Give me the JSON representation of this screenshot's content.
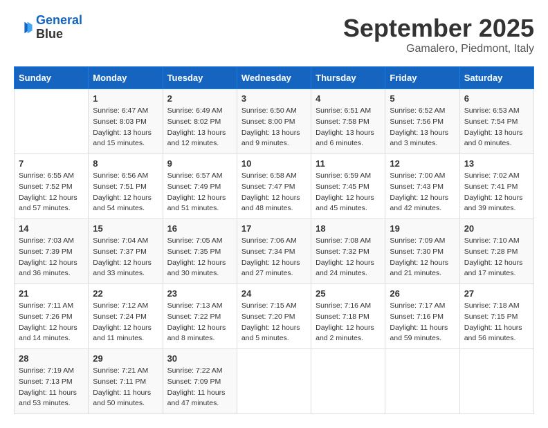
{
  "header": {
    "logo_line1": "General",
    "logo_line2": "Blue",
    "month": "September 2025",
    "location": "Gamalero, Piedmont, Italy"
  },
  "weekdays": [
    "Sunday",
    "Monday",
    "Tuesday",
    "Wednesday",
    "Thursday",
    "Friday",
    "Saturday"
  ],
  "weeks": [
    [
      null,
      {
        "day": "1",
        "sunrise": "6:47 AM",
        "sunset": "8:03 PM",
        "daylight": "13 hours and 15 minutes."
      },
      {
        "day": "2",
        "sunrise": "6:49 AM",
        "sunset": "8:02 PM",
        "daylight": "13 hours and 12 minutes."
      },
      {
        "day": "3",
        "sunrise": "6:50 AM",
        "sunset": "8:00 PM",
        "daylight": "13 hours and 9 minutes."
      },
      {
        "day": "4",
        "sunrise": "6:51 AM",
        "sunset": "7:58 PM",
        "daylight": "13 hours and 6 minutes."
      },
      {
        "day": "5",
        "sunrise": "6:52 AM",
        "sunset": "7:56 PM",
        "daylight": "13 hours and 3 minutes."
      },
      {
        "day": "6",
        "sunrise": "6:53 AM",
        "sunset": "7:54 PM",
        "daylight": "13 hours and 0 minutes."
      }
    ],
    [
      {
        "day": "7",
        "sunrise": "6:55 AM",
        "sunset": "7:52 PM",
        "daylight": "12 hours and 57 minutes."
      },
      {
        "day": "8",
        "sunrise": "6:56 AM",
        "sunset": "7:51 PM",
        "daylight": "12 hours and 54 minutes."
      },
      {
        "day": "9",
        "sunrise": "6:57 AM",
        "sunset": "7:49 PM",
        "daylight": "12 hours and 51 minutes."
      },
      {
        "day": "10",
        "sunrise": "6:58 AM",
        "sunset": "7:47 PM",
        "daylight": "12 hours and 48 minutes."
      },
      {
        "day": "11",
        "sunrise": "6:59 AM",
        "sunset": "7:45 PM",
        "daylight": "12 hours and 45 minutes."
      },
      {
        "day": "12",
        "sunrise": "7:00 AM",
        "sunset": "7:43 PM",
        "daylight": "12 hours and 42 minutes."
      },
      {
        "day": "13",
        "sunrise": "7:02 AM",
        "sunset": "7:41 PM",
        "daylight": "12 hours and 39 minutes."
      }
    ],
    [
      {
        "day": "14",
        "sunrise": "7:03 AM",
        "sunset": "7:39 PM",
        "daylight": "12 hours and 36 minutes."
      },
      {
        "day": "15",
        "sunrise": "7:04 AM",
        "sunset": "7:37 PM",
        "daylight": "12 hours and 33 minutes."
      },
      {
        "day": "16",
        "sunrise": "7:05 AM",
        "sunset": "7:35 PM",
        "daylight": "12 hours and 30 minutes."
      },
      {
        "day": "17",
        "sunrise": "7:06 AM",
        "sunset": "7:34 PM",
        "daylight": "12 hours and 27 minutes."
      },
      {
        "day": "18",
        "sunrise": "7:08 AM",
        "sunset": "7:32 PM",
        "daylight": "12 hours and 24 minutes."
      },
      {
        "day": "19",
        "sunrise": "7:09 AM",
        "sunset": "7:30 PM",
        "daylight": "12 hours and 21 minutes."
      },
      {
        "day": "20",
        "sunrise": "7:10 AM",
        "sunset": "7:28 PM",
        "daylight": "12 hours and 17 minutes."
      }
    ],
    [
      {
        "day": "21",
        "sunrise": "7:11 AM",
        "sunset": "7:26 PM",
        "daylight": "12 hours and 14 minutes."
      },
      {
        "day": "22",
        "sunrise": "7:12 AM",
        "sunset": "7:24 PM",
        "daylight": "12 hours and 11 minutes."
      },
      {
        "day": "23",
        "sunrise": "7:13 AM",
        "sunset": "7:22 PM",
        "daylight": "12 hours and 8 minutes."
      },
      {
        "day": "24",
        "sunrise": "7:15 AM",
        "sunset": "7:20 PM",
        "daylight": "12 hours and 5 minutes."
      },
      {
        "day": "25",
        "sunrise": "7:16 AM",
        "sunset": "7:18 PM",
        "daylight": "12 hours and 2 minutes."
      },
      {
        "day": "26",
        "sunrise": "7:17 AM",
        "sunset": "7:16 PM",
        "daylight": "11 hours and 59 minutes."
      },
      {
        "day": "27",
        "sunrise": "7:18 AM",
        "sunset": "7:15 PM",
        "daylight": "11 hours and 56 minutes."
      }
    ],
    [
      {
        "day": "28",
        "sunrise": "7:19 AM",
        "sunset": "7:13 PM",
        "daylight": "11 hours and 53 minutes."
      },
      {
        "day": "29",
        "sunrise": "7:21 AM",
        "sunset": "7:11 PM",
        "daylight": "11 hours and 50 minutes."
      },
      {
        "day": "30",
        "sunrise": "7:22 AM",
        "sunset": "7:09 PM",
        "daylight": "11 hours and 47 minutes."
      },
      null,
      null,
      null,
      null
    ]
  ]
}
